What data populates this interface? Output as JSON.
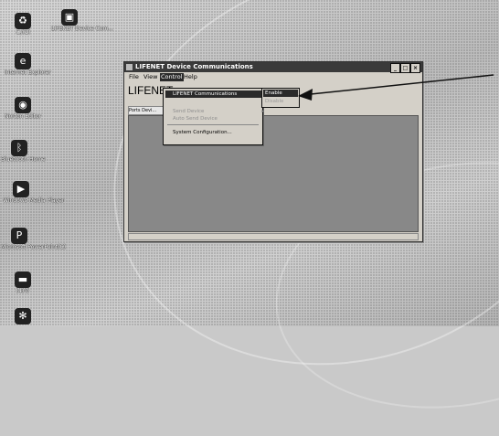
{
  "desktop": {
    "icons": [
      {
        "label": "こ/(1)",
        "icon": "recycle-bin-icon"
      },
      {
        "label": "LIFENET Device Com...",
        "icon": "lifenet-shortcut-icon"
      },
      {
        "label": "Internet Explorer",
        "icon": "internet-explorer-icon"
      },
      {
        "label": "Norton Editor",
        "icon": "norton-icon"
      },
      {
        "label": "Bluetooth Home",
        "icon": "bluetooth-icon"
      },
      {
        "label": "Windows Media Player",
        "icon": "media-player-icon"
      },
      {
        "label": "Microsoft PowerPoint(C)",
        "icon": "powerpoint-icon"
      },
      {
        "label": "(4)の",
        "icon": "folder-icon"
      },
      {
        "label": "",
        "icon": "app-icon"
      }
    ]
  },
  "window": {
    "title": "LIFENET Device Communications",
    "menu": [
      "File",
      "View",
      "Control",
      "Help"
    ],
    "app_title": "LIFENET",
    "toolstrip_text": "Ports Devi...",
    "dropdown": {
      "items": [
        {
          "label": "LIFENET Communications",
          "state": "highlighted",
          "has_submenu": true
        },
        {
          "label": "",
          "state": "disabled",
          "has_submenu": false
        },
        {
          "label": "Send Device",
          "state": "disabled",
          "has_submenu": true
        },
        {
          "label": "Auto Send Device",
          "state": "disabled",
          "has_submenu": false
        },
        {
          "label": "System Configuration...",
          "state": "enabled",
          "has_submenu": false
        }
      ]
    },
    "submenu": {
      "items": [
        {
          "label": "Enable",
          "state": "highlighted"
        },
        {
          "label": "Disable",
          "state": "disabled"
        }
      ]
    }
  }
}
